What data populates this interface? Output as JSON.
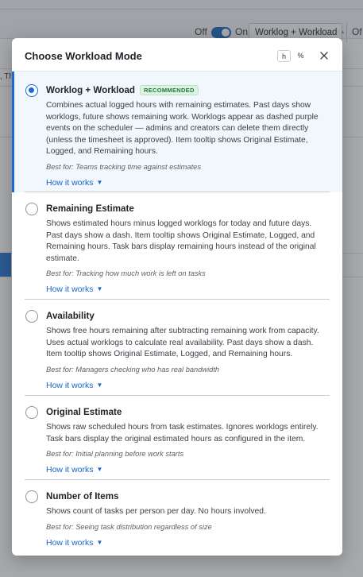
{
  "background": {
    "toggle_off_label": "Off",
    "toggle_on_label": "On",
    "mode_select_value": "Worklog + Workload",
    "right_off_label": "Of",
    "cell_text": ", Th"
  },
  "modal": {
    "title": "Choose Workload Mode",
    "hours_button": "h",
    "percent_button": "%",
    "options": [
      {
        "title": "Worklog + Workload",
        "badge": "RECOMMENDED",
        "selected": true,
        "description": "Combines actual logged hours with remaining estimates. Past days show worklogs, future shows remaining work. Worklogs appear as dashed purple events on the scheduler — admins and creators can delete them directly (unless the timesheet is approved). Item tooltip shows Original Estimate, Logged, and Remaining hours.",
        "best_for": "Best for: Teams tracking time against estimates",
        "how_it_works": "How it works"
      },
      {
        "title": "Remaining Estimate",
        "badge": "",
        "selected": false,
        "description": "Shows estimated hours minus logged worklogs for today and future days. Past days show a dash. Item tooltip shows Original Estimate, Logged, and Remaining hours. Task bars display remaining hours instead of the original estimate.",
        "best_for": "Best for: Tracking how much work is left on tasks",
        "how_it_works": "How it works"
      },
      {
        "title": "Availability",
        "badge": "",
        "selected": false,
        "description": "Shows free hours remaining after subtracting remaining work from capacity. Uses actual worklogs to calculate real availability. Past days show a dash. Item tooltip shows Original Estimate, Logged, and Remaining hours.",
        "best_for": "Best for: Managers checking who has real bandwidth",
        "how_it_works": "How it works"
      },
      {
        "title": "Original Estimate",
        "badge": "",
        "selected": false,
        "description": "Shows raw scheduled hours from task estimates. Ignores worklogs entirely. Task bars display the original estimated hours as configured in the item.",
        "best_for": "Best for: Initial planning before work starts",
        "how_it_works": "How it works"
      },
      {
        "title": "Number of Items",
        "badge": "",
        "selected": false,
        "description": "Shows count of tasks per person per day. No hours involved.",
        "best_for": "Best for: Seeing task distribution regardless of size",
        "how_it_works": "How it works"
      }
    ]
  },
  "colors": {
    "accent": "#1d6bd1",
    "selected_bg": "#f2f6fd",
    "badge_text": "#1b7a3a",
    "badge_bg": "#dff3e4",
    "link": "#1766c9"
  }
}
